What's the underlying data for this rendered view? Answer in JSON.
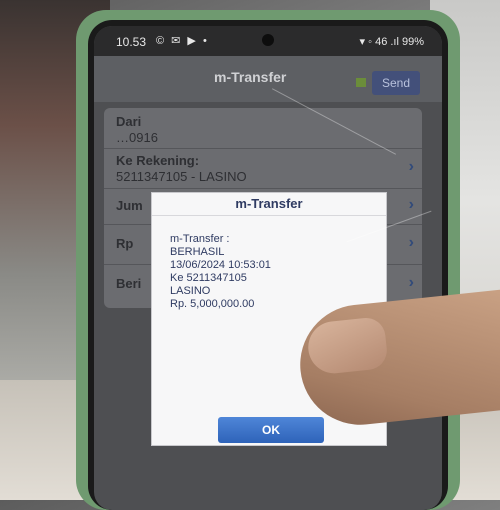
{
  "status_bar": {
    "time": "10.53",
    "notification_icons": "© ✉ ▶ •",
    "right_indicators": "▾ ◦ 46 .ıl 99%"
  },
  "app": {
    "title": "m-Transfer",
    "send_label": "Send"
  },
  "form": {
    "row1": {
      "label": "Dari",
      "value": "…0916"
    },
    "row2": {
      "label": "Ke Rekening:",
      "value": "5211347105 - LASINO"
    },
    "row3": {
      "label": "Jum"
    },
    "row4": {
      "label": "Rp"
    },
    "row5": {
      "label": "Beri"
    }
  },
  "dialog": {
    "title": "m-Transfer",
    "lines": [
      "m-Transfer :",
      "BERHASIL",
      "13/06/2024 10:53:01",
      "Ke 5211347105",
      "LASINO",
      "Rp. 5,000,000.00"
    ],
    "ok_label": "OK"
  },
  "colors": {
    "phone_case": "#6f9a70",
    "ok_button": "#3a72c8",
    "dialog_text": "#2f3b62"
  }
}
